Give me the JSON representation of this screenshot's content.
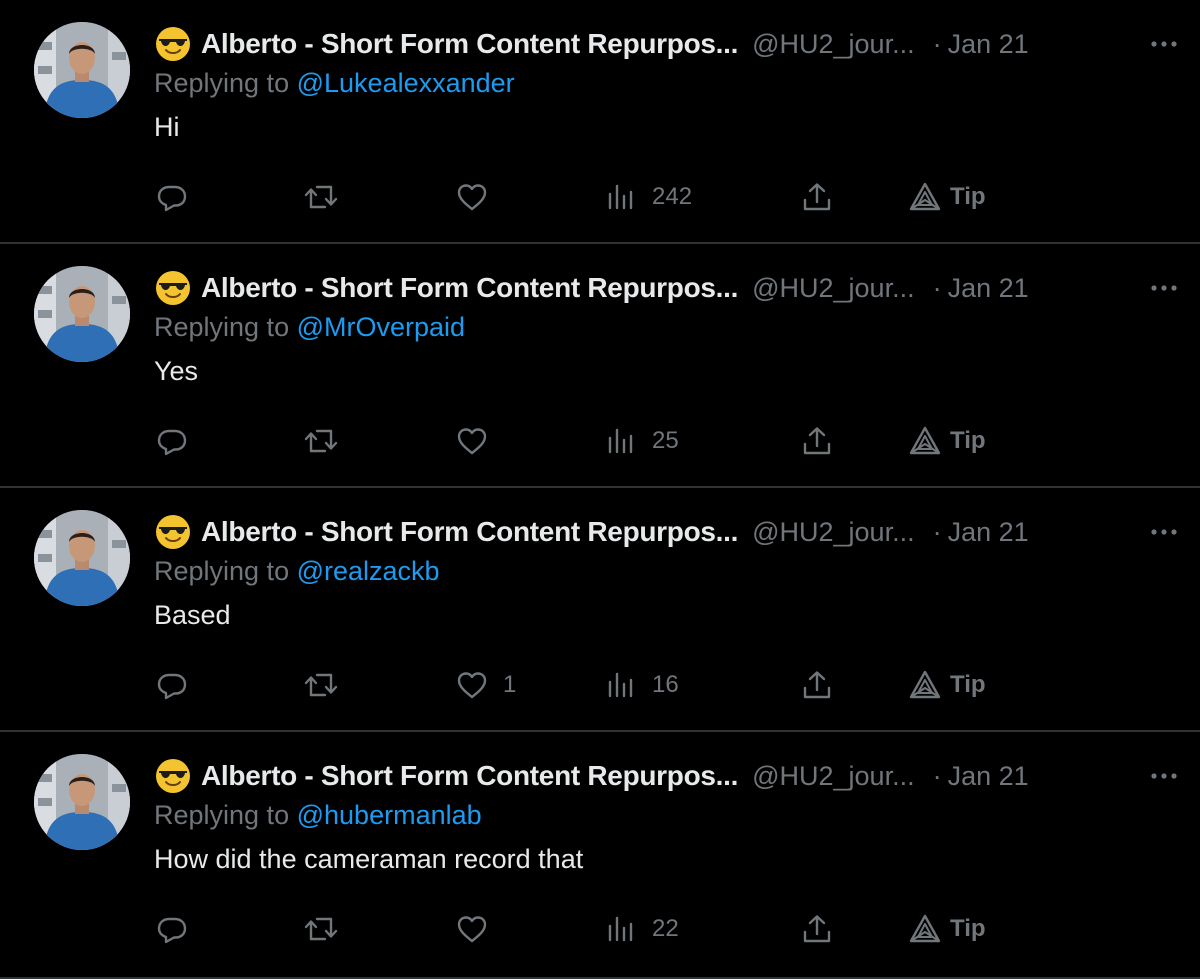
{
  "tweets": [
    {
      "name": "Alberto - Short Form Content Repurpos...",
      "handle": "@HU2_jour...",
      "dot": "·",
      "date": "Jan 21",
      "replying_prefix": "Replying to",
      "replying_to": "@Lukealexxander",
      "text": "Hi",
      "likes": "",
      "views": "242",
      "tip_label": "Tip"
    },
    {
      "name": "Alberto - Short Form Content Repurpos...",
      "handle": "@HU2_jour...",
      "dot": "·",
      "date": "Jan 21",
      "replying_prefix": "Replying to",
      "replying_to": "@MrOverpaid",
      "text": "Yes",
      "likes": "",
      "views": "25",
      "tip_label": "Tip"
    },
    {
      "name": "Alberto - Short Form Content Repurpos...",
      "handle": "@HU2_jour...",
      "dot": "·",
      "date": "Jan 21",
      "replying_prefix": "Replying to",
      "replying_to": "@realzackb",
      "text": "Based",
      "likes": "1",
      "views": "16",
      "tip_label": "Tip"
    },
    {
      "name": "Alberto - Short Form Content Repurpos...",
      "handle": "@HU2_jour...",
      "dot": "·",
      "date": "Jan 21",
      "replying_prefix": "Replying to",
      "replying_to": "@hubermanlab",
      "text": "How did the cameraman record that",
      "likes": "",
      "views": "22",
      "tip_label": "Tip"
    }
  ],
  "icons": {
    "emoji": "smiling-face-with-sunglasses-icon",
    "more": "more-horizontal-icon",
    "reply": "reply-icon",
    "retweet": "retweet-icon",
    "like": "heart-icon",
    "views": "views-icon",
    "share": "share-icon",
    "tip": "tip-icon"
  },
  "colors": {
    "background": "#000000",
    "text_primary": "#e7e9ea",
    "text_secondary": "#71767b",
    "link": "#1d9bf0",
    "divider": "#2f3336"
  }
}
